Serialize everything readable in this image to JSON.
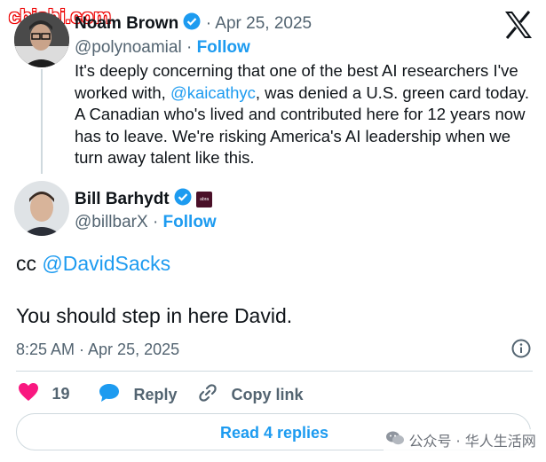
{
  "watermark": "chishi.com",
  "quoted": {
    "name": "Noam Brown",
    "date": "· Apr 25, 2025",
    "handle": "@polynoamial",
    "dot": "·",
    "follow": "Follow",
    "text_parts": {
      "line1": "It's deeply concerning that one of the best AI researchers I've",
      "line2_pre": "worked with, ",
      "mention": "@kaicathyc",
      "line2_post": ", was denied a U.S. green card today.",
      "line3": "A Canadian who's lived and contributed here for 12 years now",
      "line4": "has to leave. We're risking America's AI leadership when we",
      "line5": "turn away talent like this."
    }
  },
  "reply": {
    "name": "Bill Barhydt",
    "badge_text": "abra",
    "handle": "@billbarX",
    "dot": "·",
    "follow": "Follow",
    "cc_prefix": "cc ",
    "cc_mention": "@DavidSacks",
    "body": "You should step in here David.",
    "timestamp": "8:25 AM · Apr 25, 2025"
  },
  "actions": {
    "likes": "19",
    "reply": "Reply",
    "copy_link": "Copy link"
  },
  "read_replies": "Read 4 replies",
  "wechat_caption": "公众号 · 华人生活网",
  "icons": [
    "x-logo-icon",
    "verified-icon",
    "info-icon",
    "heart-icon",
    "reply-bubble-icon",
    "link-icon",
    "wechat-icon"
  ],
  "colors": {
    "accent": "#1d9bf0",
    "heart": "#f91880",
    "muted": "#536471"
  }
}
